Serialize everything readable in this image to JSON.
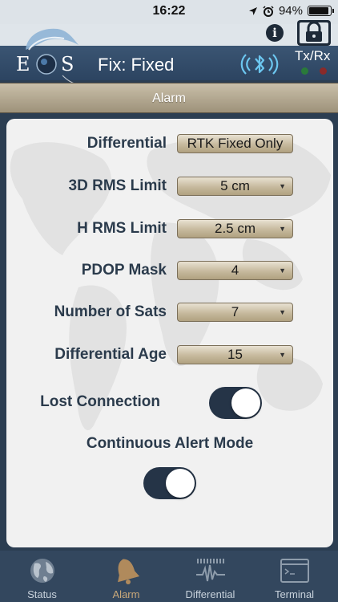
{
  "status_bar": {
    "time": "16:22",
    "battery": "94%",
    "battery_level": 0.94
  },
  "header": {
    "title": "Fix: Fixed",
    "logo_text": "EOS",
    "txrx": "Tx/Rx",
    "info": "i"
  },
  "alarm_bar": {
    "label": "Alarm"
  },
  "settings": {
    "differential": {
      "label": "Differential",
      "value": "RTK Fixed Only"
    },
    "rms3d": {
      "label": "3D RMS Limit",
      "value": "5 cm"
    },
    "hrms": {
      "label": "H RMS Limit",
      "value": "2.5 cm"
    },
    "pdop": {
      "label": "PDOP Mask",
      "value": "4"
    },
    "sats": {
      "label": "Number of Sats",
      "value": "7"
    },
    "diff_age": {
      "label": "Differential Age",
      "value": "15"
    },
    "lost_connection": {
      "label": "Lost Connection",
      "on": true
    },
    "continuous_alert": {
      "label": "Continuous Alert Mode",
      "on": true
    }
  },
  "tabs": [
    {
      "label": "Status",
      "icon": "globe-icon"
    },
    {
      "label": "Alarm",
      "icon": "bell-icon",
      "active": true
    },
    {
      "label": "Differential",
      "icon": "waveform-icon"
    },
    {
      "label": "Terminal",
      "icon": "terminal-icon"
    }
  ],
  "colors": {
    "header": "#2c4461",
    "tabbar": "#33475e",
    "alarm_bar": "#b3a68b",
    "toggle_on": "#253447",
    "active_tab": "#c9a879"
  }
}
